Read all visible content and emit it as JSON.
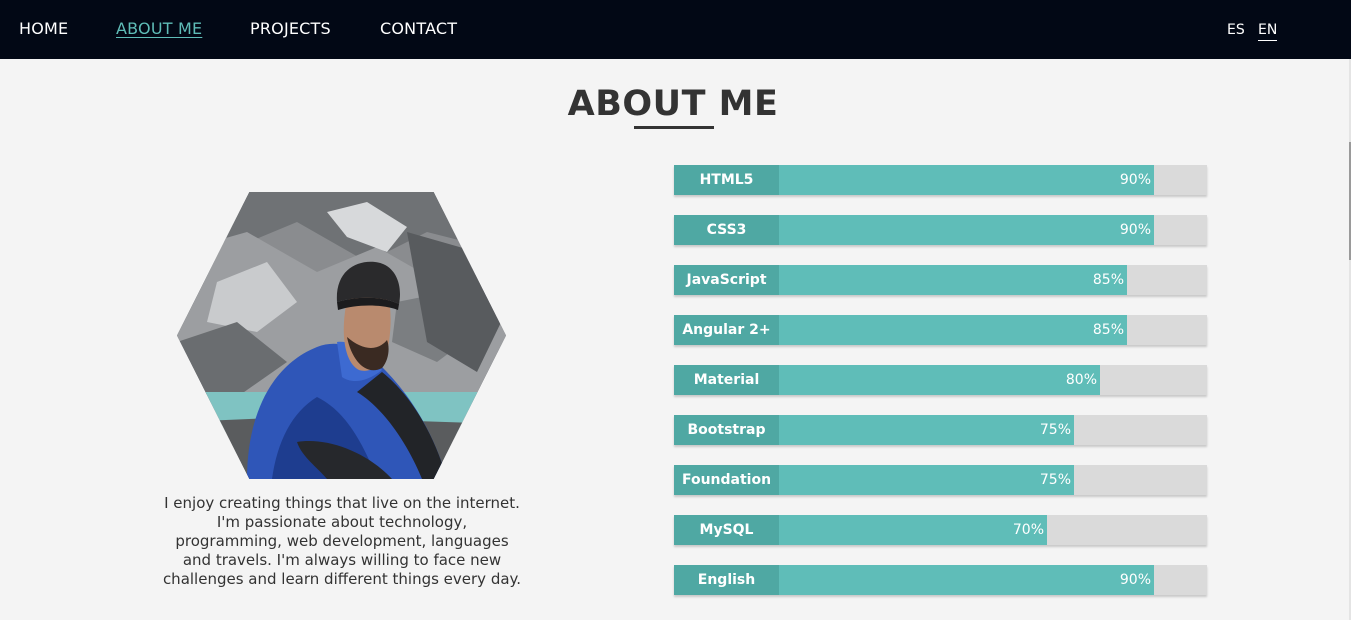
{
  "nav": {
    "items": [
      {
        "label": "HOME",
        "active": false
      },
      {
        "label": "ABOUT ME",
        "active": true
      },
      {
        "label": "PROJECTS",
        "active": false
      },
      {
        "label": "CONTACT",
        "active": false
      }
    ],
    "languages": [
      {
        "label": "ES",
        "active": false
      },
      {
        "label": "EN",
        "active": true
      }
    ]
  },
  "about": {
    "title": "ABOUT ME",
    "bio_lines": [
      "I enjoy creating things that live on the internet.",
      "I'm passionate about technology,",
      "programming, web development, languages",
      "and travels. I'm always willing to face new",
      "challenges and learn different things every day."
    ]
  },
  "skills": [
    {
      "name": "HTML5",
      "percent": 90,
      "percent_label": "90%"
    },
    {
      "name": "CSS3",
      "percent": 90,
      "percent_label": "90%"
    },
    {
      "name": "JavaScript",
      "percent": 85,
      "percent_label": "85%"
    },
    {
      "name": "Angular 2+",
      "percent": 85,
      "percent_label": "85%"
    },
    {
      "name": "Material",
      "percent": 80,
      "percent_label": "80%"
    },
    {
      "name": "Bootstrap",
      "percent": 75,
      "percent_label": "75%"
    },
    {
      "name": "Foundation",
      "percent": 75,
      "percent_label": "75%"
    },
    {
      "name": "MySQL",
      "percent": 70,
      "percent_label": "70%"
    },
    {
      "name": "English",
      "percent": 90,
      "percent_label": "90%"
    }
  ],
  "colors": {
    "navbar": "#020815",
    "accent": "#5fbdb8",
    "accent_dark": "#4fa8a3",
    "track": "#dadada",
    "text": "#333333"
  }
}
